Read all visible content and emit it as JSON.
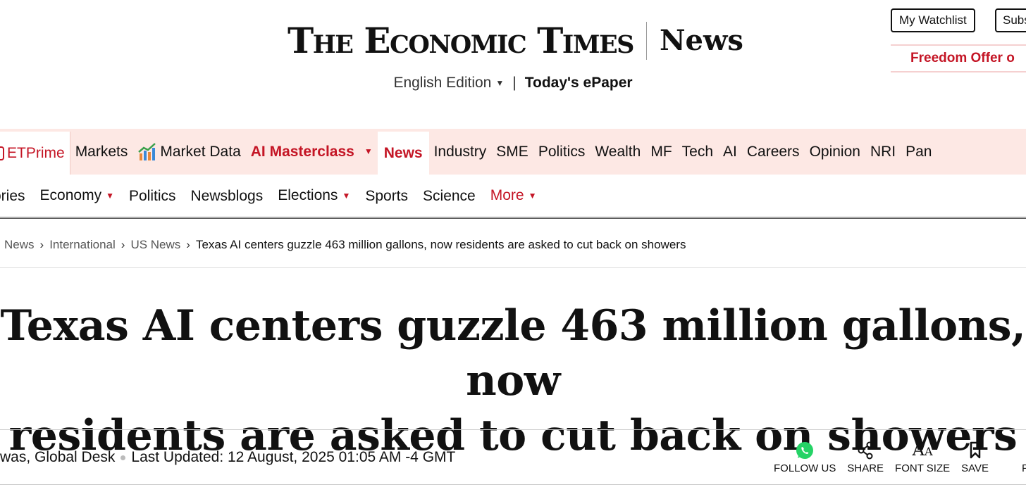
{
  "masthead": {
    "logo_text": "The Economic Times",
    "section": "News",
    "edition": "English Edition",
    "pipe": "|",
    "epaper": "Today's ePaper",
    "watchlist": "My Watchlist",
    "subscribe": "Subscribe",
    "freedom_offer": "Freedom Offer o"
  },
  "nav_primary": {
    "items": [
      {
        "label": "ETPrime"
      },
      {
        "label": "Markets"
      },
      {
        "label": "Market Data"
      },
      {
        "label": "AI Masterclass"
      },
      {
        "label": "News"
      },
      {
        "label": "Industry"
      },
      {
        "label": "SME"
      },
      {
        "label": "Politics"
      },
      {
        "label": "Wealth"
      },
      {
        "label": "MF"
      },
      {
        "label": "Tech"
      },
      {
        "label": "AI"
      },
      {
        "label": "Careers"
      },
      {
        "label": "Opinion"
      },
      {
        "label": "NRI"
      },
      {
        "label": "Pan"
      }
    ],
    "active": "News",
    "accent": "#c41525",
    "background": "#fde8e4"
  },
  "nav_secondary": {
    "items": [
      {
        "label": "ories"
      },
      {
        "label": "Economy"
      },
      {
        "label": "Politics"
      },
      {
        "label": "Newsblogs"
      },
      {
        "label": "Elections"
      },
      {
        "label": "Sports"
      },
      {
        "label": "Science"
      },
      {
        "label": "More"
      }
    ]
  },
  "breadcrumb": {
    "items": [
      "News",
      "International",
      "US News"
    ],
    "separator": "›",
    "current": "Texas AI centers guzzle 463 million gallons, now residents are asked to cut back on showers"
  },
  "article": {
    "headline_line1": "Texas AI centers guzzle 463 million gallons, now",
    "headline_line2": "residents are asked to cut back on showers",
    "byline": "was, Global Desk",
    "updated": "Last Updated: 12 August, 2025 01:05 AM -4 GMT"
  },
  "actions": {
    "follow": "FOLLOW US",
    "share": "SHARE",
    "font_size": "FONT SIZE",
    "save": "SAVE",
    "cutoff": "P"
  }
}
